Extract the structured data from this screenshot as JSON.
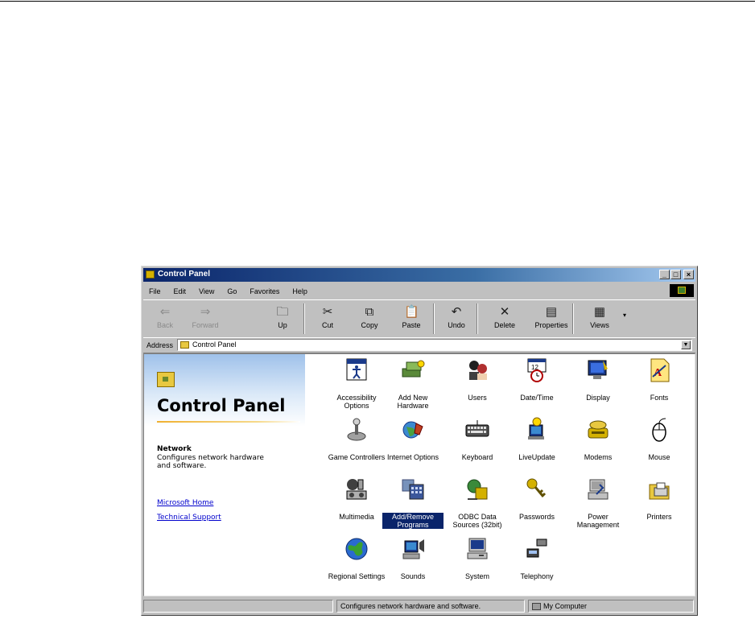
{
  "window": {
    "title": "Control Panel",
    "buttons": [
      "_",
      "□",
      "×"
    ]
  },
  "menu": [
    "File",
    "Edit",
    "View",
    "Go",
    "Favorites",
    "Help"
  ],
  "toolbar": [
    {
      "label": "Back",
      "icon": "back-arrow-icon",
      "disabled": true
    },
    {
      "label": "Forward",
      "icon": "forward-arrow-icon",
      "disabled": true
    },
    {
      "label": "Up",
      "icon": "up-folder-icon"
    },
    {
      "label": "Cut",
      "icon": "scissors-icon"
    },
    {
      "label": "Copy",
      "icon": "copy-icon"
    },
    {
      "label": "Paste",
      "icon": "paste-icon"
    },
    {
      "label": "Undo",
      "icon": "undo-icon"
    },
    {
      "label": "Delete",
      "icon": "delete-x-icon"
    },
    {
      "label": "Properties",
      "icon": "properties-icon"
    },
    {
      "label": "Views",
      "icon": "views-icon"
    }
  ],
  "address": {
    "label": "Address",
    "value": "Control Panel"
  },
  "left_panel": {
    "title": "Control Panel",
    "selected_name": "Network",
    "selected_desc": "Configures network hardware and software.",
    "links": [
      "Microsoft Home",
      "Technical Support"
    ]
  },
  "items": [
    {
      "label": "Accessibility Options",
      "icon": "accessibility-icon"
    },
    {
      "label": "Add New Hardware",
      "icon": "add-hardware-icon"
    },
    {
      "label": "Users",
      "icon": "users-icon"
    },
    {
      "label": "Date/Time",
      "icon": "date-time-icon"
    },
    {
      "label": "Display",
      "icon": "display-icon"
    },
    {
      "label": "Fonts",
      "icon": "fonts-icon"
    },
    {
      "label": "Game Controllers",
      "icon": "joystick-icon"
    },
    {
      "label": "Internet Options",
      "icon": "internet-options-icon"
    },
    {
      "label": "Keyboard",
      "icon": "keyboard-icon"
    },
    {
      "label": "LiveUpdate",
      "icon": "live-update-icon"
    },
    {
      "label": "Modems",
      "icon": "modem-icon"
    },
    {
      "label": "Mouse",
      "icon": "mouse-icon"
    },
    {
      "label": "Multimedia",
      "icon": "multimedia-icon"
    },
    {
      "label": "Add/Remove Programs",
      "icon": "add-remove-programs-icon",
      "selected": true
    },
    {
      "label": "ODBC Data Sources (32bit)",
      "icon": "odbc-icon"
    },
    {
      "label": "Passwords",
      "icon": "keys-icon"
    },
    {
      "label": "Power Management",
      "icon": "power-management-icon"
    },
    {
      "label": "Printers",
      "icon": "printers-icon"
    },
    {
      "label": "Regional Settings",
      "icon": "globe-icon"
    },
    {
      "label": "Sounds",
      "icon": "sounds-icon"
    },
    {
      "label": "System",
      "icon": "system-computer-icon"
    },
    {
      "label": "Telephony",
      "icon": "telephony-icon"
    }
  ],
  "status": {
    "message": "Configures network hardware and software.",
    "zone": "My Computer"
  }
}
